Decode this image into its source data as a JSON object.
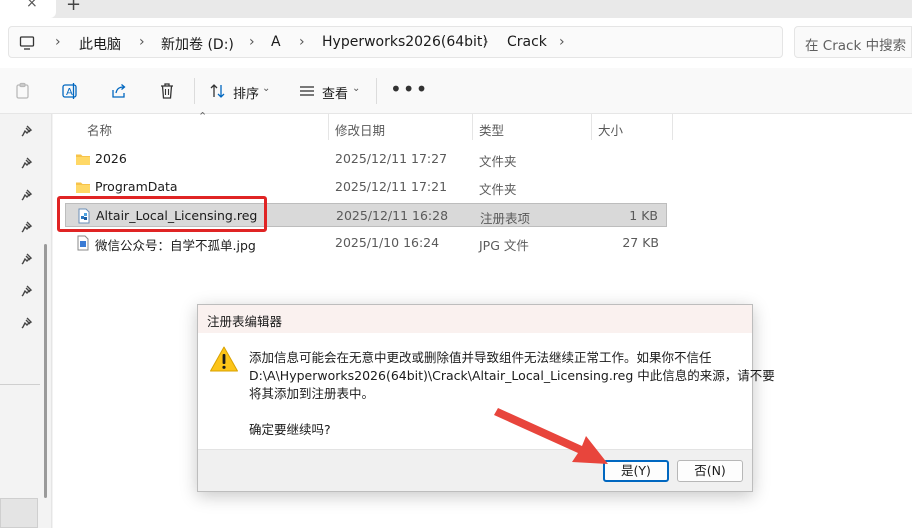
{
  "window": {
    "tab_close": "×",
    "tab_add": "+"
  },
  "address": {
    "crumbs": [
      "此电脑",
      "新加卷 (D:)",
      "A",
      "Hyperworks2026(64bit)",
      "Crack"
    ],
    "chevron": "›",
    "search_placeholder": "在 Crack 中搜索"
  },
  "toolbar": {
    "sort_label": "排序",
    "view_label": "查看",
    "more_label": "•••",
    "caret": "⌄"
  },
  "columns": {
    "name": "名称",
    "date": "修改日期",
    "type": "类型",
    "size": "大小",
    "sort_indicator": "⌃"
  },
  "files": [
    {
      "name": "2026",
      "date": "2025/12/11 17:27",
      "type": "文件夹",
      "size": "",
      "icon": "folder-icon"
    },
    {
      "name": "ProgramData",
      "date": "2025/12/11 17:21",
      "type": "文件夹",
      "size": "",
      "icon": "folder-icon"
    },
    {
      "name": "Altair_Local_Licensing.reg",
      "date": "2025/12/11 16:28",
      "type": "注册表项",
      "size": "1 KB",
      "icon": "registry-file-icon",
      "selected": true
    },
    {
      "name": "微信公众号：自学不孤单.jpg",
      "date": "2025/1/10 16:24",
      "type": "JPG 文件",
      "size": "27 KB",
      "icon": "image-file-icon"
    }
  ],
  "dialog": {
    "title": "注册表编辑器",
    "message_line1": "添加信息可能会在无意中更改或删除值并导致组件无法继续正常工作。如果你不信任",
    "message_line2": "D:\\A\\Hyperworks2026(64bit)\\Crack\\Altair_Local_Licensing.reg 中此信息的来源，请不要",
    "message_line3": "将其添加到注册表中。",
    "question": "确定要继续吗?",
    "yes_button": "是(Y)",
    "no_button": "否(N)"
  },
  "colors": {
    "selection": "#d9d9d9",
    "highlight_box": "#e02424",
    "arrow": "#e8453c",
    "primary_border": "#0067c0",
    "folder": "#f7c34a",
    "dialog_title_bg": "#faf1ef"
  }
}
